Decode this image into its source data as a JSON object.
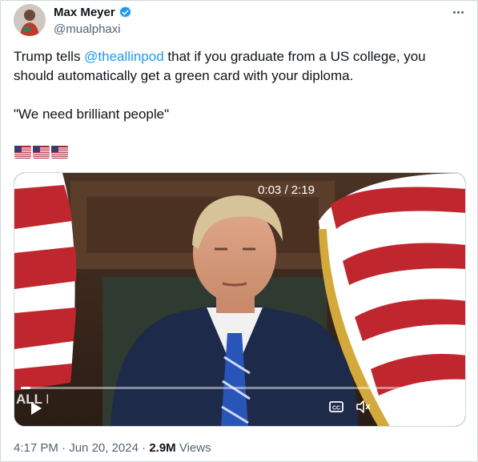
{
  "author": {
    "display_name": "Max Meyer",
    "handle": "@mualphaxi",
    "avatar_icon": "avatar-photo",
    "verified_icon": "verified-badge-icon",
    "verified_color": "#1d9bf0"
  },
  "tweet": {
    "text_before_mention": "Trump tells ",
    "mention": "@theallinpod",
    "text_after_mention": " that if you graduate from a US college, you should automatically get a green card with your diploma.",
    "quote": "\"We need brilliant people\"",
    "emoji_flags": [
      "us-flag",
      "us-flag",
      "us-flag"
    ]
  },
  "video": {
    "watermark": "ALL IN",
    "current_time": "0:03",
    "separator": " / ",
    "duration": "2:19",
    "progress_fraction": 0.022
  },
  "meta": {
    "time": "4:17 PM",
    "dot1": " · ",
    "date": "Jun 20, 2024",
    "dot2": " · ",
    "views_count": "2.9M",
    "views_label": " Views"
  },
  "colors": {
    "text_primary": "#0f1419",
    "text_secondary": "#536471",
    "link": "#1d9bf0"
  }
}
